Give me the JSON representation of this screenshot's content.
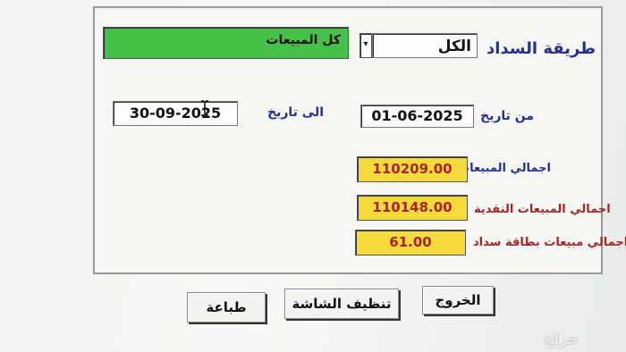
{
  "form": {
    "payment_method_label": "طريقة السداد",
    "payment_method_value": "الكل",
    "sales_type_value": "كل المبيعات",
    "from_date_label": "من تاريخ",
    "from_date_value": "01-06-2025",
    "to_date_label": "الى تاريخ",
    "to_date_value": "30-09-2025"
  },
  "totals": {
    "total_sales_label": "اجمالي المبيعات",
    "total_sales_value": "110209.00",
    "cash_sales_label": "اجمالي المبيعات النقدية",
    "cash_sales_value": "110148.00",
    "card_sales_label": "اجمالي مبيعات بطاقة سداد",
    "card_sales_value": "61.00"
  },
  "buttons": {
    "exit_label": "الخروج",
    "clear_label": "تنظيف الشاشة",
    "print_label": "طباعة"
  },
  "watermark": "حراج",
  "colors": {
    "label_blue": "#25308c",
    "label_red": "#a52624",
    "highlight_green": "#47c04a",
    "total_yellow": "#f6d93b"
  }
}
